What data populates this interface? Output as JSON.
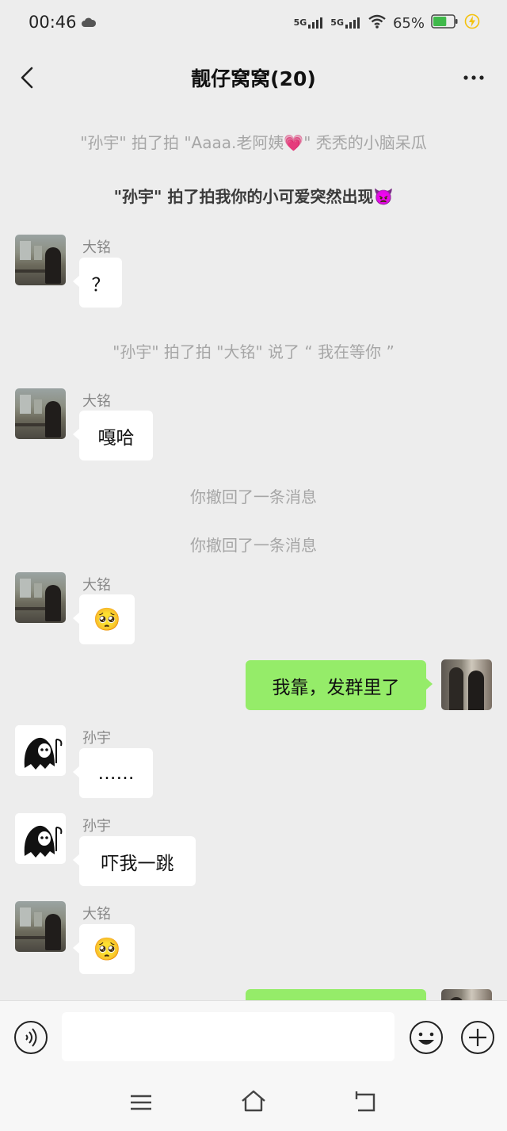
{
  "status_bar": {
    "time": "00:46",
    "signal1": "5G",
    "signal2": "5G",
    "battery_percent": "65%",
    "battery_level": 0.65,
    "icons": [
      "cloud-icon",
      "signal-icon",
      "wifi-icon",
      "battery-icon",
      "charging-icon"
    ]
  },
  "header": {
    "title": "靓仔窝窝(20)",
    "back_icon": "chevron-left-icon",
    "more_icon": "more-horizontal-icon"
  },
  "messages": {
    "sys1": "\"孙宇\" 拍了拍 \"Aaaa.老阿姨💗\" 秃秃的小脑呆瓜",
    "sys2": "\"孙宇\" 拍了拍我你的小可爱突然出现👿",
    "m1_sender": "大铭",
    "m1_text": "？",
    "sys3": "\"孙宇\" 拍了拍 \"大铭\" 说了 “ 我在等你 ”",
    "m2_sender": "大铭",
    "m2_text": "嘎哈",
    "sys4": "你撤回了一条消息",
    "sys5": "你撤回了一条消息",
    "m3_sender": "大铭",
    "m3_emoji": "🥺",
    "m4_text": "我靠，发群里了",
    "m5_sender": "孙宇",
    "m5_text": "……",
    "m6_sender": "孙宇",
    "m6_text": "吓我一跳",
    "m7_sender": "大铭",
    "m7_emoji": "🥺"
  },
  "input_bar": {
    "voice_icon": "voice-icon",
    "emoji_icon": "emoji-icon",
    "plus_icon": "plus-icon",
    "text": ""
  },
  "system_nav": {
    "icons": [
      "menu-icon",
      "home-icon",
      "back-icon"
    ]
  },
  "colors": {
    "background": "#ededed",
    "my_bubble": "#95ec69",
    "other_bubble": "#ffffff",
    "system_text": "#a6a6a6"
  }
}
